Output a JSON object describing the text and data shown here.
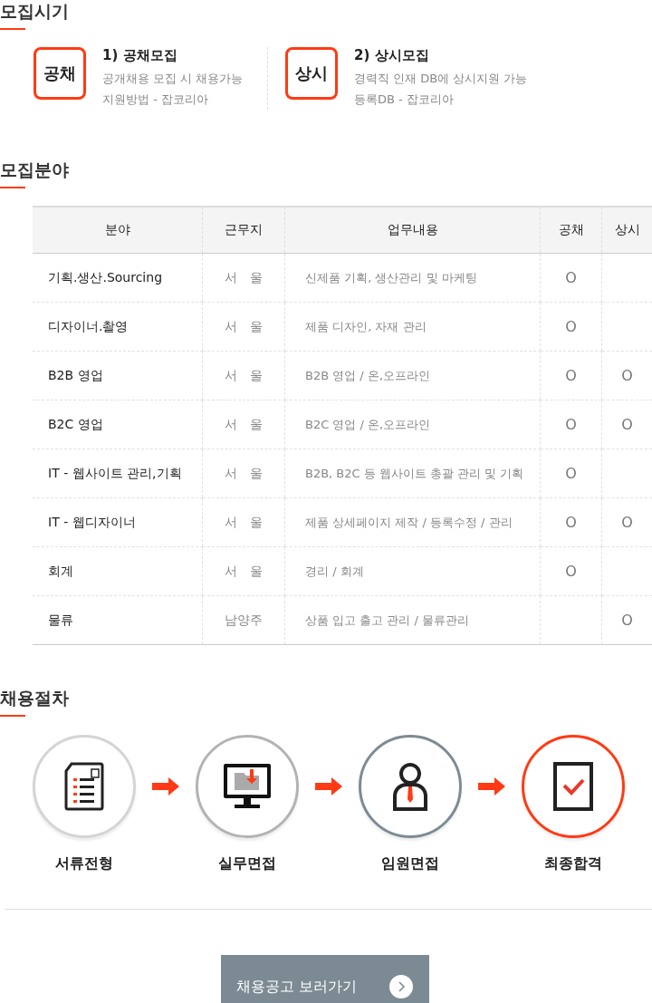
{
  "recruit_period": {
    "title": "모집시기",
    "types": [
      {
        "badge": "공채",
        "title": "1) 공채모집",
        "lines": [
          "공개채용 모집 시 채용가능",
          "지원방법 - 잡코리아"
        ]
      },
      {
        "badge": "상시",
        "title": "2) 상시모집",
        "lines": [
          "경력직 인재 DB에 상시지원 가능",
          "등록DB - 잡코리아"
        ]
      }
    ]
  },
  "recruit_fields": {
    "title": "모집분야",
    "table": {
      "columns": [
        "분야",
        "근무지",
        "업무내용",
        "공채",
        "상시"
      ],
      "rows": [
        {
          "field": "기획.생산.Sourcing",
          "location": "서　울",
          "duties": "신제품 기획, 생산관리 및 마케팅",
          "open": "O"
        },
        {
          "field": "디자이너.촬영",
          "location": "서　울",
          "duties": "제품 디자인, 자재 관리",
          "open": "O"
        },
        {
          "field": "B2B 영업",
          "location": "서　울",
          "duties": "B2B 영업 / 온,오프라인",
          "open": "O",
          "always": "O"
        },
        {
          "field": "B2C 영업",
          "location": "서　울",
          "duties": "B2C 영업 / 온,오프라인",
          "open": "O",
          "always": "O"
        },
        {
          "field": "IT - 웹사이트 관리,기획",
          "location": "서　울",
          "duties": "B2B, B2C 등 웹사이트 총괄 관리 및 기획",
          "open": "O"
        },
        {
          "field": "IT - 웹디자이너",
          "location": "서　울",
          "duties": "제품 상세페이지 제작 / 등록수정 / 관리",
          "open": "O",
          "always": "O"
        },
        {
          "field": "회계",
          "location": "서　울",
          "duties": "경리 / 회계",
          "open": "O"
        },
        {
          "field": "물류",
          "location": "남양주",
          "duties": "상품 입고 출고 관리 / 물류관리",
          "always": "O"
        }
      ]
    }
  },
  "process": {
    "title": "채용절차",
    "steps": [
      {
        "kind": "document",
        "label": "서류전형",
        "color": "#d4d4d4"
      },
      {
        "kind": "monitor",
        "label": "실무면접",
        "color": "#b3b3b3"
      },
      {
        "kind": "person",
        "label": "임원면접",
        "color": "#7d8b93"
      },
      {
        "kind": "check",
        "label": "최종합격",
        "color": "#ff3a14"
      }
    ]
  },
  "button": {
    "label": "채용공고 보러가기"
  }
}
